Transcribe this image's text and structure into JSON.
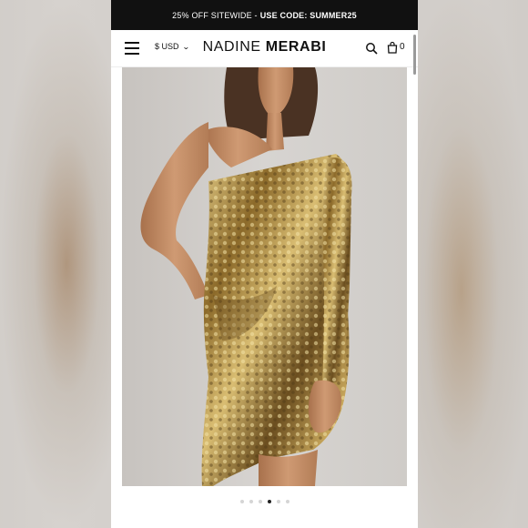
{
  "promo": {
    "text": "25% OFF SITEWIDE - ",
    "code": "USE CODE: SUMMER25"
  },
  "header": {
    "currency": "$ USD",
    "logo_light": "NADINE ",
    "logo_bold": "MERABI",
    "cart_count": "0"
  },
  "icons": {
    "menu": "hamburger-icon",
    "search": "search-icon",
    "bag": "bag-icon",
    "currency_toggle": "chevron-down-icon"
  },
  "product_image": {
    "subject": "gold sequin one-shoulder mini dress",
    "colors": {
      "sequin": "#b8943f",
      "skin": "#c58f66",
      "hair": "#4a3223",
      "backdrop": "#d2cfcb"
    }
  },
  "carousel": {
    "total": 6,
    "active_index": 3
  }
}
